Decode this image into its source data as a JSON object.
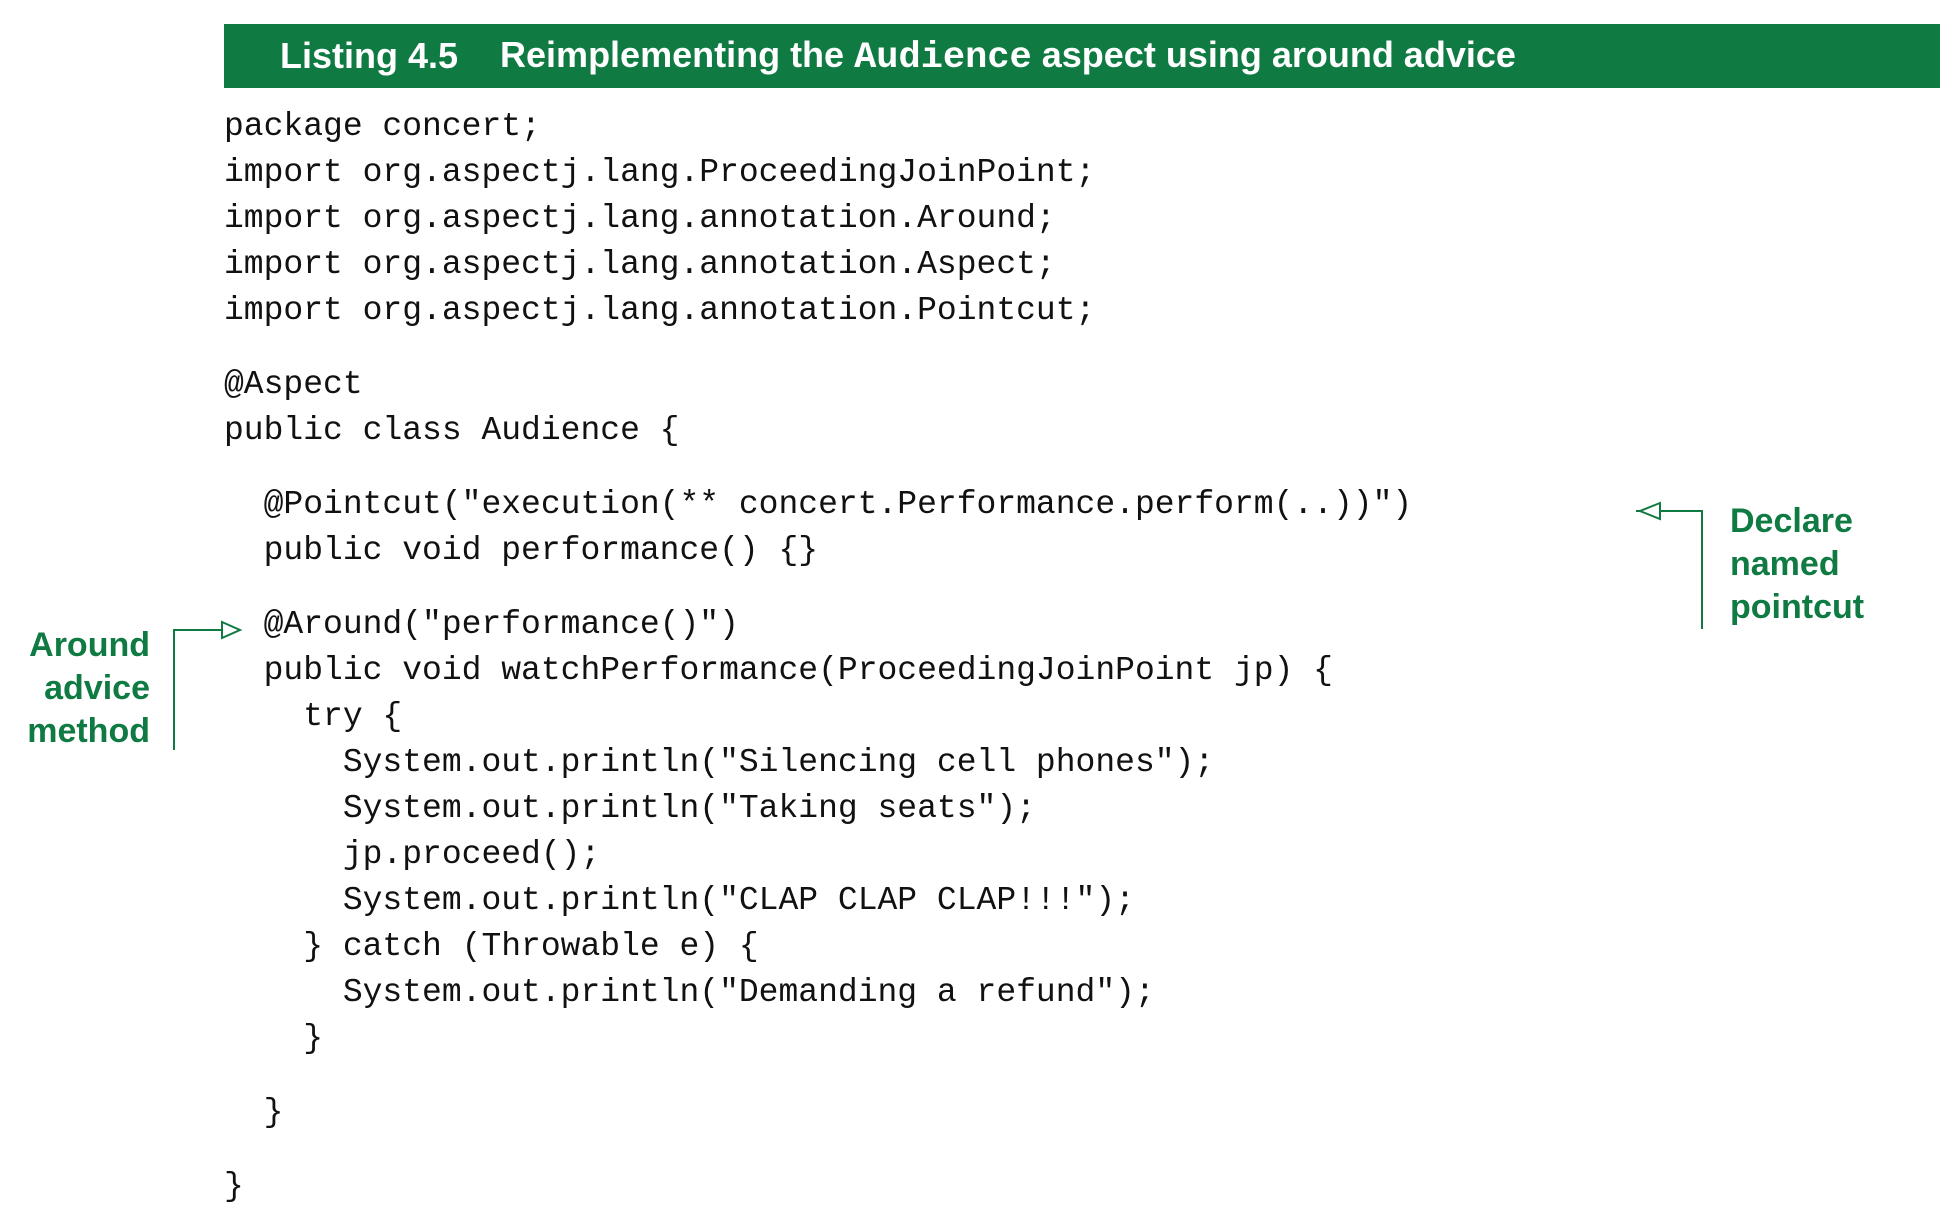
{
  "listing": {
    "number": "Listing 4.5",
    "title_prefix": "Reimplementing the",
    "title_code": "Audience",
    "title_suffix": "aspect using around advice"
  },
  "code": {
    "block1": [
      "package concert;",
      "import org.aspectj.lang.ProceedingJoinPoint;",
      "import org.aspectj.lang.annotation.Around;",
      "import org.aspectj.lang.annotation.Aspect;",
      "import org.aspectj.lang.annotation.Pointcut;"
    ],
    "block2": [
      "@Aspect",
      "public class Audience {"
    ],
    "block3": [
      "  @Pointcut(\"execution(** concert.Performance.perform(..))\")",
      "  public void performance() {}"
    ],
    "block4": [
      "  @Around(\"performance()\")",
      "  public void watchPerformance(ProceedingJoinPoint jp) {",
      "    try {",
      "      System.out.println(\"Silencing cell phones\");",
      "      System.out.println(\"Taking seats\");",
      "      jp.proceed();",
      "      System.out.println(\"CLAP CLAP CLAP!!!\");",
      "    } catch (Throwable e) {",
      "      System.out.println(\"Demanding a refund\");",
      "    }"
    ],
    "block5": [
      "  }"
    ],
    "block6": [
      "}"
    ]
  },
  "annotations": {
    "around_advice": [
      "Around",
      "advice",
      "method"
    ],
    "named_pointcut": [
      "Declare",
      "named",
      "pointcut"
    ]
  },
  "colors": {
    "accent": "#0f7a42"
  }
}
